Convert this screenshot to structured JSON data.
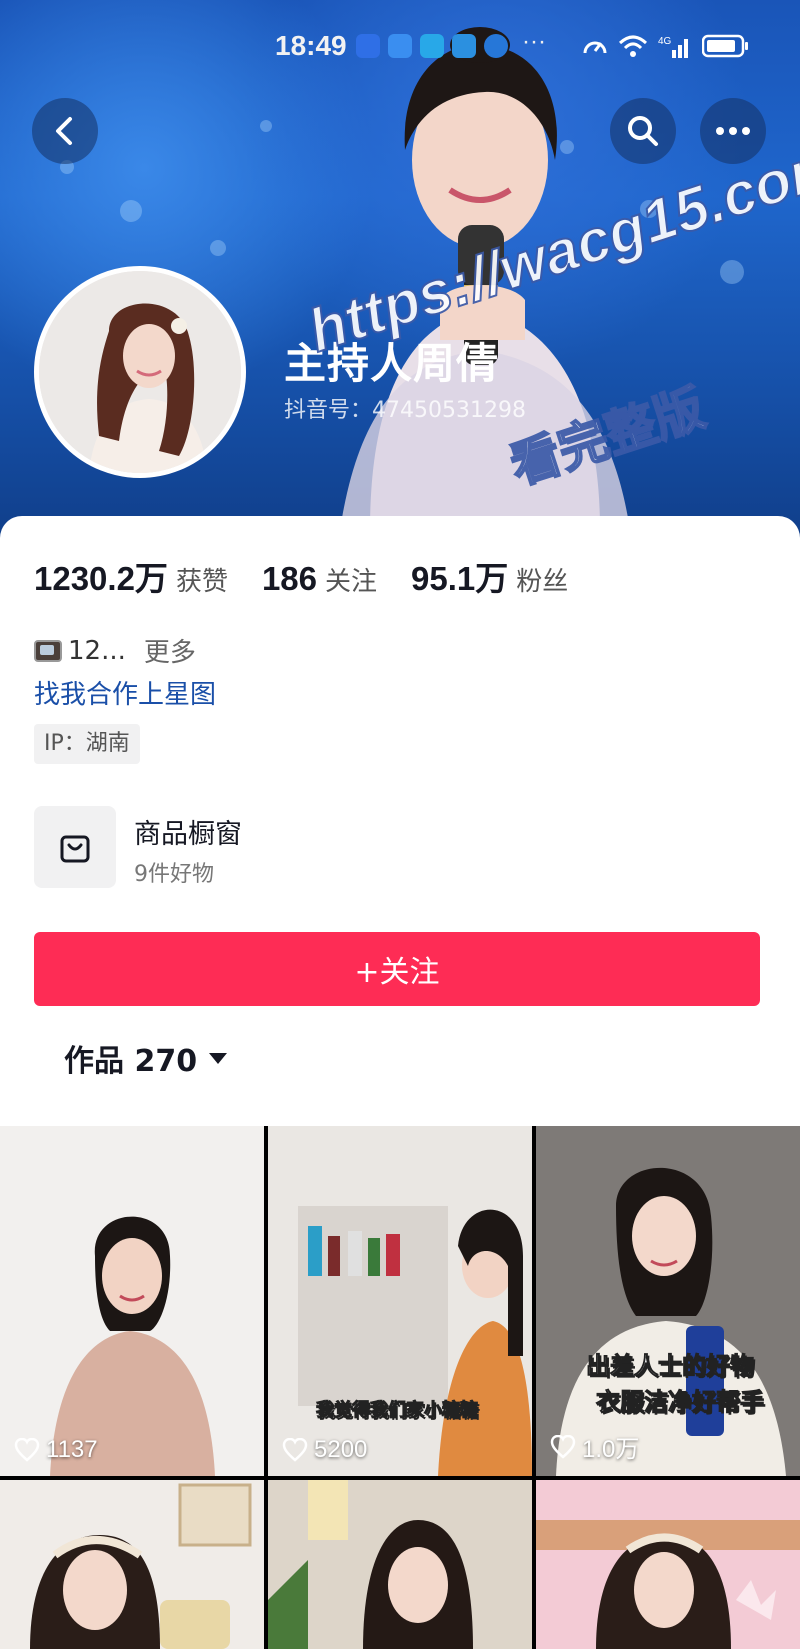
{
  "status": {
    "time": "18:49",
    "more": "···"
  },
  "profile": {
    "name": "主持人周倩",
    "douyin_id": "抖音号：47450531298"
  },
  "watermark": {
    "line1": "https://wacg15.com",
    "line2": "看完整版"
  },
  "stats": [
    {
      "value": "1230.2万",
      "label": "获赞"
    },
    {
      "value": "186",
      "label": "关注"
    },
    {
      "value": "95.1万",
      "label": "粉丝"
    }
  ],
  "bio": {
    "text": "12...",
    "more": "更多",
    "collab_link": "找我合作上星图",
    "ip": "IP：湖南"
  },
  "shop": {
    "title": "商品橱窗",
    "subtitle": "9件好物"
  },
  "follow_button": "+关注",
  "works_tab": {
    "label": "作品 270"
  },
  "videos": [
    {
      "likes": "1137",
      "caption": ""
    },
    {
      "likes": "5200",
      "caption": "我觉得我们家小糖糖"
    },
    {
      "likes": "1.0万",
      "caption": "出差人士的好物",
      "caption2": "衣服洁净好帮手"
    },
    {
      "likes": "",
      "caption": ""
    },
    {
      "likes": "",
      "caption": ""
    },
    {
      "likes": "",
      "caption": ""
    }
  ],
  "colors": {
    "accent": "#fe2c55",
    "link": "#1a4fa8"
  }
}
